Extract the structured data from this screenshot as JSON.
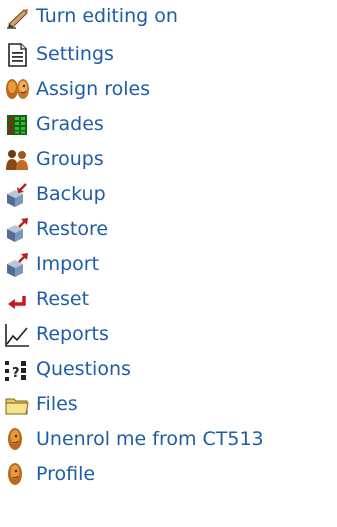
{
  "admin_menu": {
    "items": [
      {
        "label": "Turn editing on",
        "icon": "edit-pencil-icon"
      },
      {
        "label": "Settings",
        "icon": "settings-document-icon"
      },
      {
        "label": "Assign roles",
        "icon": "assign-roles-icon"
      },
      {
        "label": "Grades",
        "icon": "grades-grid-icon"
      },
      {
        "label": "Groups",
        "icon": "groups-people-icon"
      },
      {
        "label": "Backup",
        "icon": "backup-box-icon"
      },
      {
        "label": "Restore",
        "icon": "restore-box-icon"
      },
      {
        "label": "Import",
        "icon": "import-box-icon"
      },
      {
        "label": "Reset",
        "icon": "reset-arrow-icon"
      },
      {
        "label": "Reports",
        "icon": "reports-chart-icon"
      },
      {
        "label": "Questions",
        "icon": "questions-icon"
      },
      {
        "label": "Files",
        "icon": "files-folder-icon"
      },
      {
        "label": "Unenrol me from CT513",
        "icon": "unenrol-person-icon"
      },
      {
        "label": "Profile",
        "icon": "profile-person-icon"
      }
    ]
  },
  "colors": {
    "link": "#1f5ca8",
    "background": "#ffffff"
  }
}
